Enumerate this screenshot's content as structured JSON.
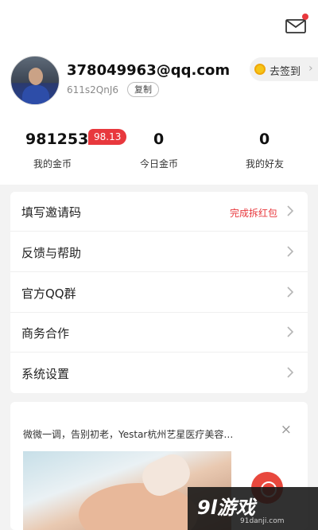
{
  "header": {
    "email": "378049963@qq.com",
    "uid": "611s2QnJ6",
    "copy_label": "复制",
    "checkin_label": "去签到"
  },
  "stats": [
    {
      "value": "981253",
      "label": "我的金币",
      "badge": "98.13"
    },
    {
      "value": "0",
      "label": "今日金币"
    },
    {
      "value": "0",
      "label": "我的好友"
    }
  ],
  "menu": [
    {
      "label": "填写邀请码",
      "extra": "完成拆红包"
    },
    {
      "label": "反馈与帮助"
    },
    {
      "label": "官方QQ群"
    },
    {
      "label": "商务合作"
    },
    {
      "label": "系统设置"
    }
  ],
  "ad": {
    "text": "微微一调，告别初老，Yestar杭州艺星医疗美容…",
    "close": "×"
  },
  "watermark": {
    "logo": "9l游戏",
    "url": "91danji.com"
  },
  "colors": {
    "accent_red": "#e8383d",
    "coin_yellow": "#f5c518"
  },
  "icons": {
    "mail": "mail-icon",
    "coin": "coin-icon",
    "chevron": "chevron-right-icon",
    "close": "close-icon"
  }
}
